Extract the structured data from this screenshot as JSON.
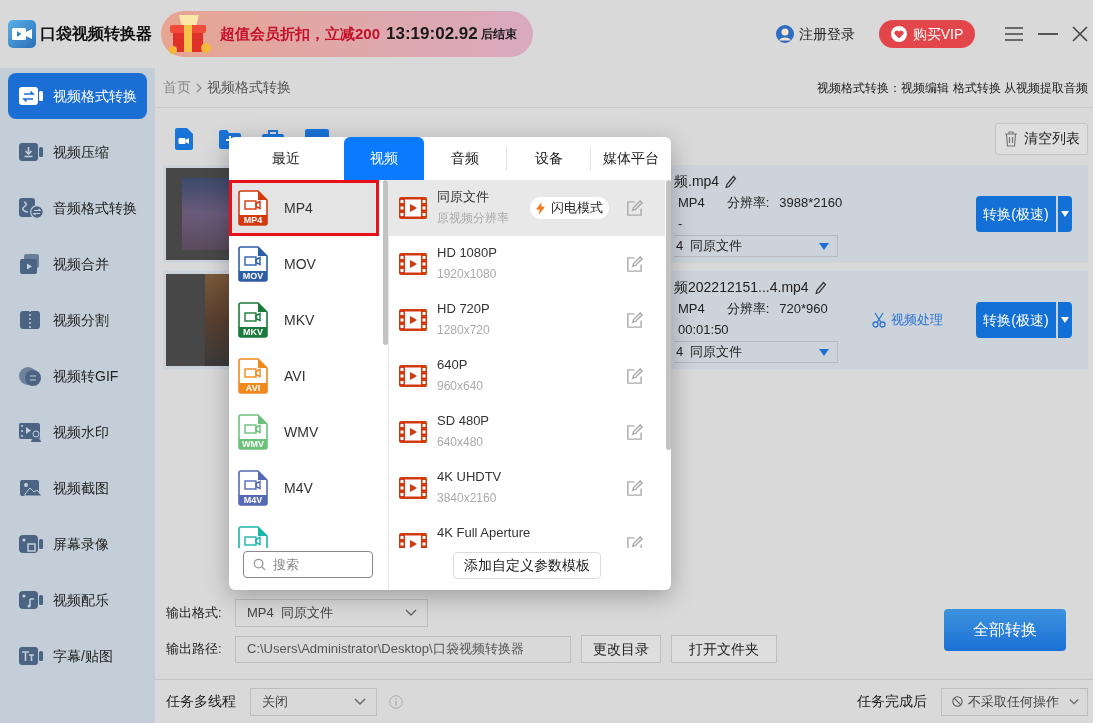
{
  "app": {
    "title": "口袋视频转换器"
  },
  "promo": {
    "offer": "超值会员折扣，立减200",
    "countdown": "13:19:02.92",
    "suffix": "后结束"
  },
  "account": {
    "login": "注册登录",
    "vip": "购买VIP"
  },
  "sidebar": {
    "items": [
      {
        "label": "视频格式转换",
        "selected": true
      },
      {
        "label": "视频压缩",
        "selected": false
      },
      {
        "label": "音频格式转换",
        "selected": false
      },
      {
        "label": "视频合并",
        "selected": false
      },
      {
        "label": "视频分割",
        "selected": false
      },
      {
        "label": "视频转GIF",
        "selected": false
      },
      {
        "label": "视频水印",
        "selected": false
      },
      {
        "label": "视频截图",
        "selected": false
      },
      {
        "label": "屏幕录像",
        "selected": false
      },
      {
        "label": "视频配乐",
        "selected": false
      },
      {
        "label": "字幕/贴图",
        "selected": false
      }
    ]
  },
  "breadcrumb": [
    "首页",
    "视频格式转换"
  ],
  "feature_hint": "视频格式转换：视频编辑 格式转换 从视频提取音频",
  "toolbar": {
    "clear_button": "清空列表"
  },
  "files": [
    {
      "name": "频.mp4",
      "format": "MP4",
      "resolution_label": "分辨率:",
      "resolution": "3988*2160",
      "duration": "-",
      "output": "4  同原文件",
      "convert_button": "转换(极速)"
    },
    {
      "name": "频202212151...4.mp4",
      "format": "MP4",
      "resolution_label": "分辨率:",
      "resolution": "720*960",
      "duration": "00:01:50",
      "tool": "视频处理",
      "output": "4  同原文件",
      "convert_button": "转换(极速)"
    }
  ],
  "format_popup": {
    "tabs": [
      {
        "label": "最近",
        "selected": false
      },
      {
        "label": "视频",
        "selected": true
      },
      {
        "label": "音频",
        "selected": false
      },
      {
        "label": "设备",
        "selected": false
      },
      {
        "label": "媒体平台",
        "selected": false
      }
    ],
    "formats": [
      {
        "label": "MP4",
        "badge": "MP4",
        "color": "#d4380d",
        "selected": true
      },
      {
        "label": "MOV",
        "badge": "MOV",
        "color": "#2f5ea8",
        "selected": false
      },
      {
        "label": "MKV",
        "badge": "MKV",
        "color": "#1a7a3c",
        "selected": false
      },
      {
        "label": "AVI",
        "badge": "AVI",
        "color": "#f08a1c",
        "selected": false
      },
      {
        "label": "WMV",
        "badge": "WMV",
        "color": "#6cc17a",
        "selected": false
      },
      {
        "label": "M4V",
        "badge": "M4V",
        "color": "#5569b5",
        "selected": false
      },
      {
        "color": "#1cb5ab",
        "selected": false
      }
    ],
    "search": {
      "placeholder": "搜索"
    },
    "presets": [
      {
        "title": "同原文件",
        "detail": "原视频分辨率",
        "badge": "闪电模式",
        "selected": true
      },
      {
        "title": "HD 1080P",
        "detail": "1920x1080",
        "selected": false
      },
      {
        "title": "HD 720P",
        "detail": "1280x720",
        "selected": false
      },
      {
        "title": "640P",
        "detail": "960x640",
        "selected": false
      },
      {
        "title": "SD 480P",
        "detail": "640x480",
        "selected": false
      },
      {
        "title": "4K UHDTV",
        "detail": "3840x2160",
        "selected": false
      },
      {
        "title": "4K Full Aperture",
        "selected": false
      }
    ],
    "add_template_button": "添加自定义参数模板"
  },
  "output": {
    "format_label": "输出格式:",
    "format_value": "MP4  同原文件",
    "path_label": "输出路径:",
    "path_value": "C:\\Users\\Administrator\\Desktop\\口袋视频转换器",
    "change_dir_button": "更改目录",
    "open_folder_button": "打开文件夹",
    "convert_all_button": "全部转换"
  },
  "task_bar": {
    "threads_label": "任务多线程",
    "threads_value": "关闭",
    "after_label": "任务完成后",
    "after_value": "不采取任何操作"
  }
}
